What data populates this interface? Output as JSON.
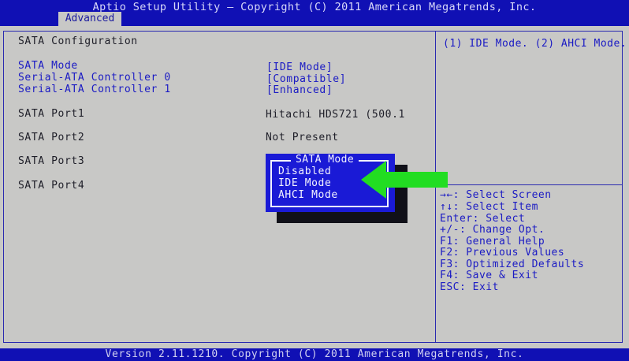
{
  "header": {
    "title": "Aptio Setup Utility – Copyright (C) 2011 American Megatrends, Inc.",
    "active_tab": "Advanced"
  },
  "main": {
    "section_title": "SATA Configuration",
    "settings": [
      {
        "label": "SATA Mode",
        "value": "[IDE Mode]"
      },
      {
        "label": "Serial-ATA Controller 0",
        "value": "[Compatible]"
      },
      {
        "label": "Serial-ATA Controller 1",
        "value": "[Enhanced]"
      }
    ],
    "ports": [
      {
        "label": "SATA Port1",
        "value": "Hitachi HDS721 (500.1"
      },
      {
        "label": "SATA Port2",
        "value": "Not Present"
      },
      {
        "label": "SATA Port3",
        "value": ""
      },
      {
        "label": "SATA Port4",
        "value": ""
      }
    ]
  },
  "popup": {
    "title": "SATA Mode",
    "options": [
      "Disabled",
      "IDE Mode",
      "AHCI Mode"
    ],
    "selected": "IDE Mode"
  },
  "help": {
    "description": "(1) IDE Mode. (2) AHCI Mode.",
    "keys": [
      "→←: Select Screen",
      "↑↓: Select Item",
      "Enter: Select",
      "+/-: Change Opt.",
      "F1: General Help",
      "F2: Previous Values",
      "F3: Optimized Defaults",
      "F4: Save & Exit",
      "ESC: Exit"
    ]
  },
  "footer": {
    "text": "Version 2.11.1210. Copyright (C) 2011 American Megatrends, Inc."
  },
  "colors": {
    "bar_blue": "#1010b4",
    "popup_blue": "#1a1ad6",
    "background_gray": "#c8c8c6",
    "arrow_green": "#22dd22"
  },
  "annotation_icon": "green-arrow-icon"
}
